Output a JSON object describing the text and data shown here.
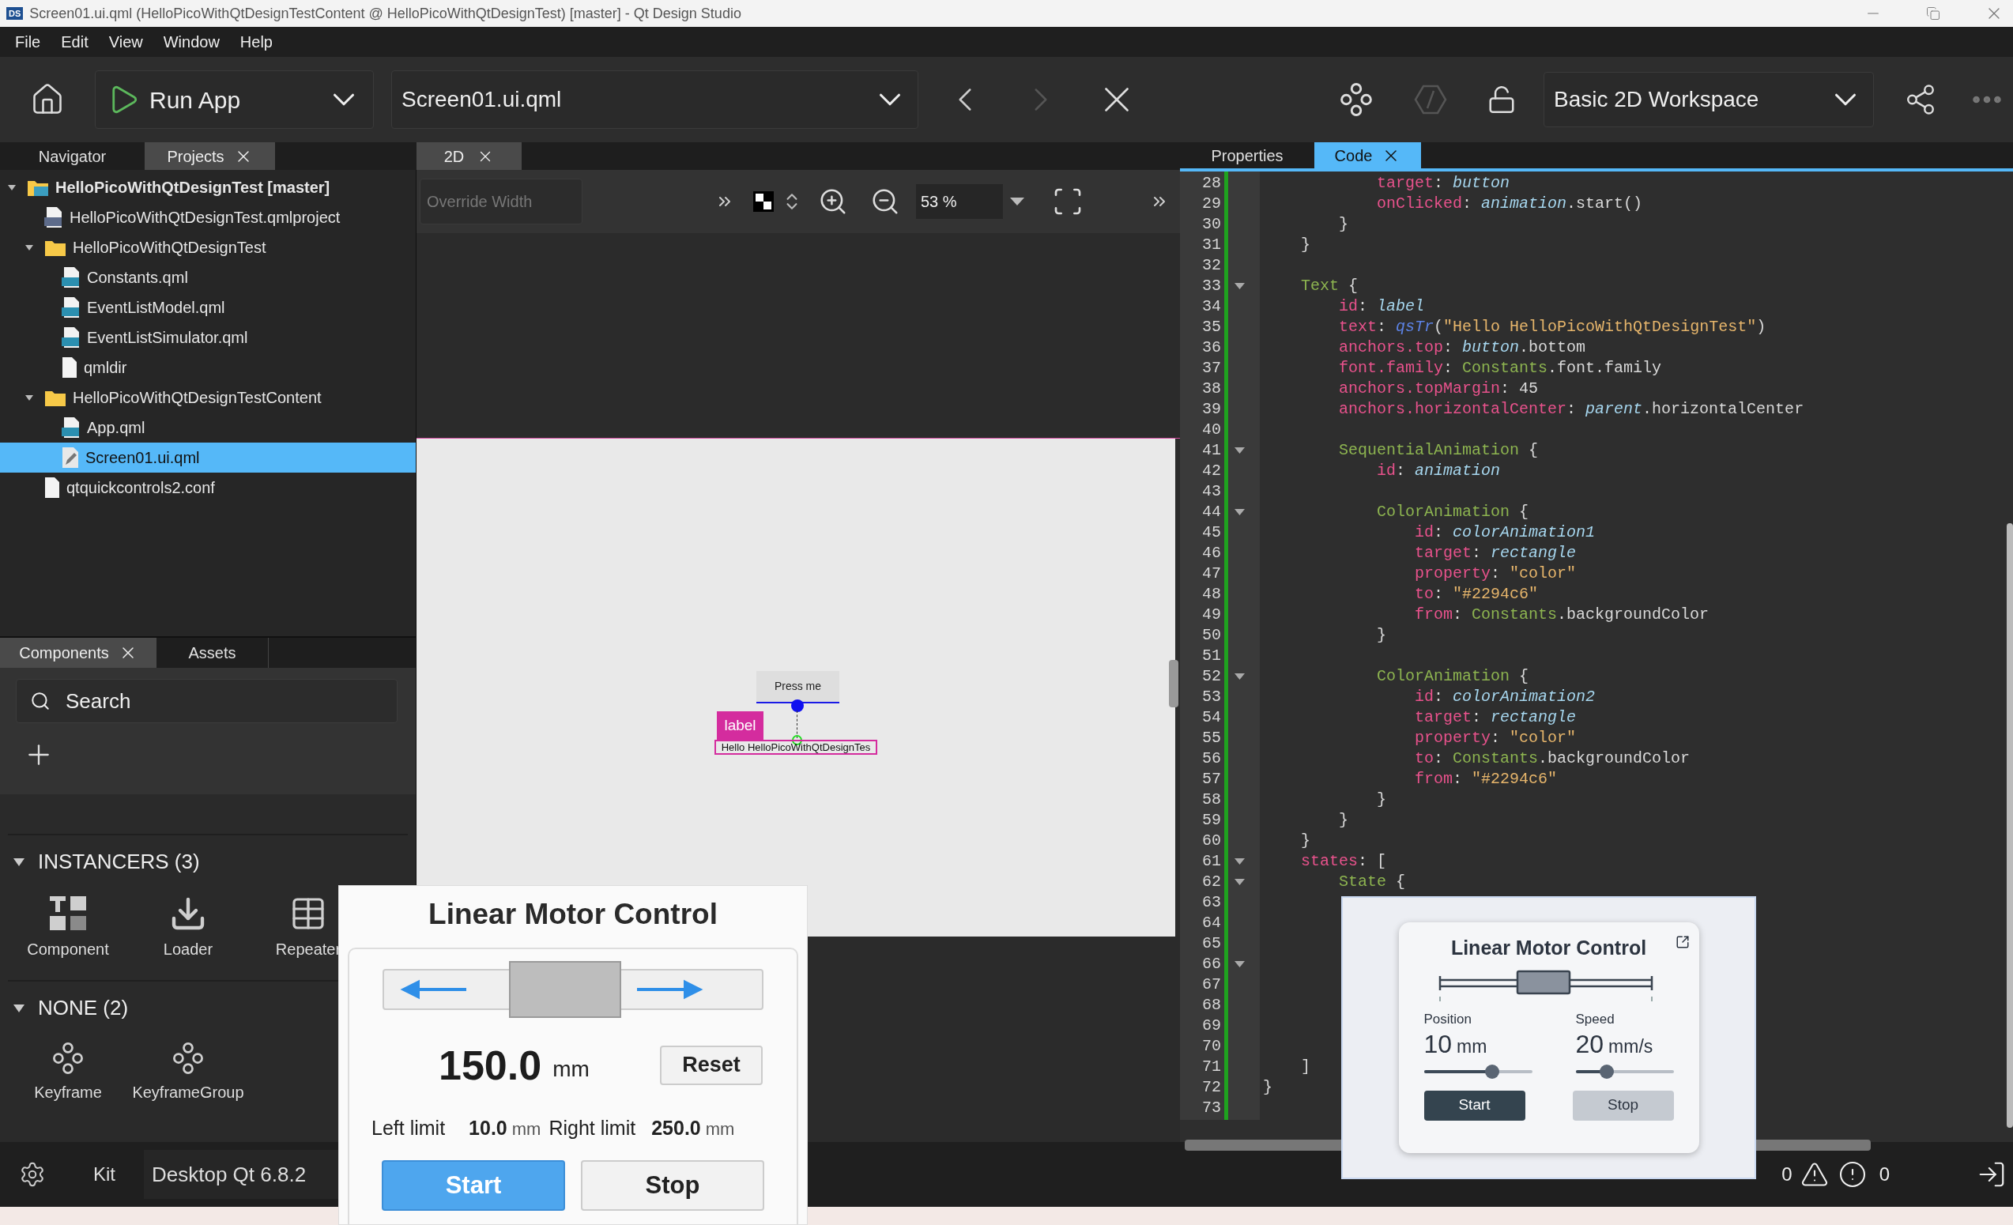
{
  "window": {
    "title": "Screen01.ui.qml (HelloPicoWithQtDesignTestContent @ HelloPicoWithQtDesignTest) [master] - Qt Design Studio",
    "badge": "DS"
  },
  "menu": [
    "File",
    "Edit",
    "View",
    "Window",
    "Help"
  ],
  "toolbar": {
    "run_label": "Run App",
    "file": "Screen01.ui.qml",
    "workspace": "Basic 2D Workspace",
    "forward_disabled": true
  },
  "left_tabs": [
    {
      "label": "Navigator",
      "selected": false
    },
    {
      "label": "Projects",
      "selected": true
    }
  ],
  "tree": [
    {
      "label": "HelloPicoWithQtDesignTest [master]",
      "kind": "project",
      "expanded": true,
      "selected": false,
      "children": [
        {
          "label": "HelloPicoWithQtDesignTest.qmlproject",
          "kind": "qmlproject",
          "selected": false
        },
        {
          "label": "HelloPicoWithQtDesignTest",
          "kind": "folder",
          "expanded": true,
          "selected": false,
          "children": [
            {
              "label": "Constants.qml",
              "kind": "qml",
              "selected": false
            },
            {
              "label": "EventListModel.qml",
              "kind": "qml",
              "selected": false
            },
            {
              "label": "EventListSimulator.qml",
              "kind": "qml",
              "selected": false
            },
            {
              "label": "qmldir",
              "kind": "file",
              "selected": false
            }
          ]
        },
        {
          "label": "HelloPicoWithQtDesignTestContent",
          "kind": "folder",
          "expanded": true,
          "selected": false,
          "children": [
            {
              "label": "App.qml",
              "kind": "qml",
              "selected": false
            },
            {
              "label": "Screen01.ui.qml",
              "kind": "edit",
              "selected": true
            }
          ]
        },
        {
          "label": "qtquickcontrols2.conf",
          "kind": "file",
          "selected": false
        }
      ]
    }
  ],
  "components": {
    "tabs": [
      {
        "label": "Components",
        "selected": true
      },
      {
        "label": "Assets",
        "selected": false
      }
    ],
    "search": {
      "placeholder": "Search"
    },
    "sections": [
      {
        "title": "INSTANCERS (3)",
        "expanded": true,
        "items": [
          {
            "label": "Component",
            "kind": "component"
          },
          {
            "label": "Loader",
            "kind": "loader"
          },
          {
            "label": "Repeater",
            "kind": "repeater"
          }
        ]
      },
      {
        "title": "NONE (2)",
        "expanded": true,
        "items": [
          {
            "label": "Keyframe",
            "kind": "keyframe"
          },
          {
            "label": "KeyframeGroup",
            "kind": "keyframe"
          }
        ]
      }
    ]
  },
  "editor": {
    "tab": {
      "label": "2D",
      "selected": true
    },
    "override_width": {
      "placeholder": "Override Width"
    },
    "zoom": "53 %",
    "canvas": {
      "button": "Press me",
      "tag": "label",
      "text": "Hello HelloPicoWithQtDesignTes"
    }
  },
  "right_tabs": [
    {
      "label": "Properties",
      "selected": false
    },
    {
      "label": "Code",
      "selected": true
    }
  ],
  "code": [
    {
      "n": "28",
      "fold": false,
      "segs": [
        {
          "kind": "key",
          "text": "            target"
        },
        {
          "kind": "plain",
          "text": ": "
        },
        {
          "kind": "id",
          "text": "button"
        }
      ]
    },
    {
      "n": "29",
      "fold": false,
      "segs": [
        {
          "kind": "key",
          "text": "            onClicked"
        },
        {
          "kind": "plain",
          "text": ": "
        },
        {
          "kind": "id",
          "text": "animation"
        },
        {
          "kind": "plain",
          "text": ".start()"
        }
      ]
    },
    {
      "n": "30",
      "fold": false,
      "segs": [
        {
          "kind": "plain",
          "text": "        }"
        }
      ]
    },
    {
      "n": "31",
      "fold": false,
      "segs": [
        {
          "kind": "plain",
          "text": "    }"
        }
      ]
    },
    {
      "n": "32",
      "fold": false
    },
    {
      "n": "33",
      "fold": true,
      "segs": [
        {
          "kind": "type",
          "text": "    Text"
        },
        {
          "kind": "plain",
          "text": " {"
        }
      ]
    },
    {
      "n": "34",
      "fold": false,
      "segs": [
        {
          "kind": "key",
          "text": "        id"
        },
        {
          "kind": "plain",
          "text": ": "
        },
        {
          "kind": "id",
          "text": "label"
        }
      ]
    },
    {
      "n": "35",
      "fold": false,
      "segs": [
        {
          "kind": "key",
          "text": "        text"
        },
        {
          "kind": "plain",
          "text": ": "
        },
        {
          "kind": "fn",
          "text": "qsTr"
        },
        {
          "kind": "plain",
          "text": "("
        },
        {
          "kind": "str",
          "text": "\"Hello HelloPicoWithQtDesignTest\""
        },
        {
          "kind": "plain",
          "text": ")"
        }
      ]
    },
    {
      "n": "36",
      "fold": false,
      "segs": [
        {
          "kind": "key",
          "text": "        anchors.top"
        },
        {
          "kind": "plain",
          "text": ": "
        },
        {
          "kind": "id",
          "text": "button"
        },
        {
          "kind": "plain",
          "text": ".bottom"
        }
      ]
    },
    {
      "n": "37",
      "fold": false,
      "segs": [
        {
          "kind": "key",
          "text": "        font.family"
        },
        {
          "kind": "plain",
          "text": ": "
        },
        {
          "kind": "type",
          "text": "Constants"
        },
        {
          "kind": "plain",
          "text": ".font.family"
        }
      ]
    },
    {
      "n": "38",
      "fold": false,
      "segs": [
        {
          "kind": "key",
          "text": "        anchors.topMargin"
        },
        {
          "kind": "plain",
          "text": ": 45"
        }
      ]
    },
    {
      "n": "39",
      "fold": false,
      "segs": [
        {
          "kind": "key",
          "text": "        anchors.horizontalCenter"
        },
        {
          "kind": "plain",
          "text": ": "
        },
        {
          "kind": "id",
          "text": "parent"
        },
        {
          "kind": "plain",
          "text": ".horizontalCenter"
        }
      ]
    },
    {
      "n": "40",
      "fold": false
    },
    {
      "n": "41",
      "fold": true,
      "segs": [
        {
          "kind": "type",
          "text": "        SequentialAnimation"
        },
        {
          "kind": "plain",
          "text": " {"
        }
      ]
    },
    {
      "n": "42",
      "fold": false,
      "segs": [
        {
          "kind": "key",
          "text": "            id"
        },
        {
          "kind": "plain",
          "text": ": "
        },
        {
          "kind": "id",
          "text": "animation"
        }
      ]
    },
    {
      "n": "43",
      "fold": false
    },
    {
      "n": "44",
      "fold": true,
      "segs": [
        {
          "kind": "type",
          "text": "            ColorAnimation"
        },
        {
          "kind": "plain",
          "text": " {"
        }
      ]
    },
    {
      "n": "45",
      "fold": false,
      "segs": [
        {
          "kind": "key",
          "text": "                id"
        },
        {
          "kind": "plain",
          "text": ": "
        },
        {
          "kind": "id",
          "text": "colorAnimation1"
        }
      ]
    },
    {
      "n": "46",
      "fold": false,
      "segs": [
        {
          "kind": "key",
          "text": "                target"
        },
        {
          "kind": "plain",
          "text": ": "
        },
        {
          "kind": "id",
          "text": "rectangle"
        }
      ]
    },
    {
      "n": "47",
      "fold": false,
      "segs": [
        {
          "kind": "key",
          "text": "                property"
        },
        {
          "kind": "plain",
          "text": ": "
        },
        {
          "kind": "str",
          "text": "\"color\""
        }
      ]
    },
    {
      "n": "48",
      "fold": false,
      "segs": [
        {
          "kind": "key",
          "text": "                to"
        },
        {
          "kind": "plain",
          "text": ": "
        },
        {
          "kind": "str",
          "text": "\"#2294c6\""
        }
      ]
    },
    {
      "n": "49",
      "fold": false,
      "segs": [
        {
          "kind": "key",
          "text": "                from"
        },
        {
          "kind": "plain",
          "text": ": "
        },
        {
          "kind": "type",
          "text": "Constants"
        },
        {
          "kind": "plain",
          "text": ".backgroundColor"
        }
      ]
    },
    {
      "n": "50",
      "fold": false,
      "segs": [
        {
          "kind": "plain",
          "text": "            }"
        }
      ]
    },
    {
      "n": "51",
      "fold": false
    },
    {
      "n": "52",
      "fold": true,
      "segs": [
        {
          "kind": "type",
          "text": "            ColorAnimation"
        },
        {
          "kind": "plain",
          "text": " {"
        }
      ]
    },
    {
      "n": "53",
      "fold": false,
      "segs": [
        {
          "kind": "key",
          "text": "                id"
        },
        {
          "kind": "plain",
          "text": ": "
        },
        {
          "kind": "id",
          "text": "colorAnimation2"
        }
      ]
    },
    {
      "n": "54",
      "fold": false,
      "segs": [
        {
          "kind": "key",
          "text": "                target"
        },
        {
          "kind": "plain",
          "text": ": "
        },
        {
          "kind": "id",
          "text": "rectangle"
        }
      ]
    },
    {
      "n": "55",
      "fold": false,
      "segs": [
        {
          "kind": "key",
          "text": "                property"
        },
        {
          "kind": "plain",
          "text": ": "
        },
        {
          "kind": "str",
          "text": "\"color\""
        }
      ]
    },
    {
      "n": "56",
      "fold": false,
      "segs": [
        {
          "kind": "key",
          "text": "                to"
        },
        {
          "kind": "plain",
          "text": ": "
        },
        {
          "kind": "type",
          "text": "Constants"
        },
        {
          "kind": "plain",
          "text": ".backgroundColor"
        }
      ]
    },
    {
      "n": "57",
      "fold": false,
      "segs": [
        {
          "kind": "key",
          "text": "                from"
        },
        {
          "kind": "plain",
          "text": ": "
        },
        {
          "kind": "str",
          "text": "\"#2294c6\""
        }
      ]
    },
    {
      "n": "58",
      "fold": false,
      "segs": [
        {
          "kind": "plain",
          "text": "            }"
        }
      ]
    },
    {
      "n": "59",
      "fold": false,
      "segs": [
        {
          "kind": "plain",
          "text": "        }"
        }
      ]
    },
    {
      "n": "60",
      "fold": false,
      "segs": [
        {
          "kind": "plain",
          "text": "    }"
        }
      ]
    },
    {
      "n": "61",
      "fold": true,
      "segs": [
        {
          "kind": "key",
          "text": "    states"
        },
        {
          "kind": "plain",
          "text": ": ["
        }
      ]
    },
    {
      "n": "62",
      "fold": true,
      "segs": [
        {
          "kind": "type",
          "text": "        State"
        },
        {
          "kind": "plain",
          "text": " {"
        }
      ]
    },
    {
      "n": "63",
      "fold": false
    },
    {
      "n": "64",
      "fold": false
    },
    {
      "n": "65",
      "fold": false
    },
    {
      "n": "66",
      "fold": true
    },
    {
      "n": "67",
      "fold": false
    },
    {
      "n": "68",
      "fold": false
    },
    {
      "n": "69",
      "fold": false
    },
    {
      "n": "70",
      "fold": false
    },
    {
      "n": "71",
      "fold": false,
      "segs": [
        {
          "kind": "plain",
          "text": "    ]"
        }
      ]
    },
    {
      "n": "72",
      "fold": false,
      "segs": [
        {
          "kind": "plain",
          "text": "}"
        }
      ]
    },
    {
      "n": "73",
      "fold": false
    }
  ],
  "status_bar": {
    "kit_label": "Kit",
    "kit": "Desktop Qt 6.8.2",
    "warnings": "0",
    "errors": "0"
  },
  "motor_window": {
    "title": "Linear Motor Control",
    "value": "150.0",
    "unit": "mm",
    "reset": "Reset",
    "left_label": "Left limit",
    "left_value": "10.0",
    "left_unit": "mm",
    "right_label": "Right limit",
    "right_value": "250.0",
    "right_unit": "mm",
    "buttons": [
      {
        "label": "Start",
        "kind": "primary"
      },
      {
        "label": "Stop",
        "kind": "secondary"
      }
    ]
  },
  "motor_card": {
    "title": "Linear Motor Control",
    "readouts": [
      {
        "label": "Position",
        "value": "10",
        "unit": "mm",
        "level": 0.63
      },
      {
        "label": "Speed",
        "value": "20",
        "unit": "mm/s",
        "level": 0.32
      }
    ],
    "buttons": [
      {
        "label": "Start",
        "kind": "primary"
      },
      {
        "label": "Stop",
        "kind": "secondary"
      }
    ]
  }
}
